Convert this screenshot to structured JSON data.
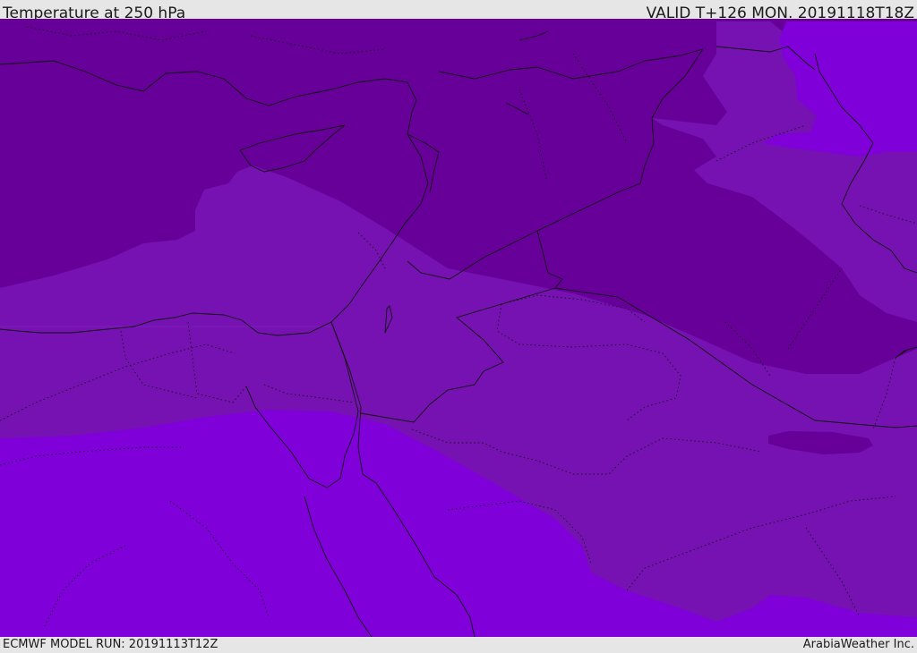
{
  "header": {
    "title": "Temperature at 250 hPa",
    "valid": "VALID T+126 MON. 20191118T18Z"
  },
  "footer": {
    "model_run": "ECMWF MODEL RUN: 20191113T12Z",
    "credit": "ArabiaWeather Inc."
  },
  "colors": {
    "band_dark": "#660099",
    "band_mid": "#7612b2",
    "band_light": "#7f00d9",
    "boundary_line": "#111111"
  }
}
